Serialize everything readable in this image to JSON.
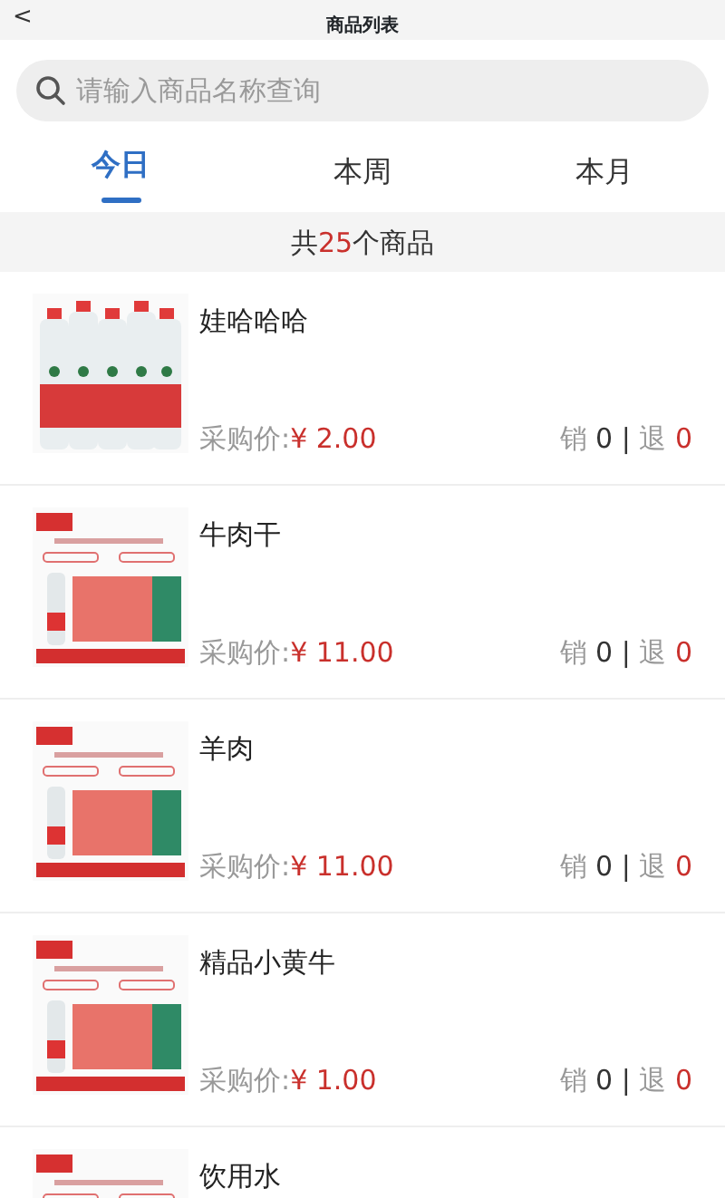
{
  "header": {
    "back": "<",
    "title": "商品列表"
  },
  "search": {
    "placeholder": "请输入商品名称查询"
  },
  "tabs": [
    {
      "label": "今日",
      "selected": true
    },
    {
      "label": "本周",
      "selected": false
    },
    {
      "label": "本月",
      "selected": false
    }
  ],
  "summary": {
    "prefix": "共",
    "count": "25",
    "suffix": "个商品"
  },
  "products": [
    {
      "name": "娃哈哈哈",
      "price_label": "采购价:",
      "price": "¥ 2.00",
      "sold_label": "销",
      "sold": "0",
      "separator": "|",
      "returned_label": "退",
      "returned": "0"
    },
    {
      "name": "牛肉干",
      "price_label": "采购价:",
      "price": "¥ 11.00",
      "sold_label": "销",
      "sold": "0",
      "separator": "|",
      "returned_label": "退",
      "returned": "0"
    },
    {
      "name": "羊肉",
      "price_label": "采购价:",
      "price": "¥ 11.00",
      "sold_label": "销",
      "sold": "0",
      "separator": "|",
      "returned_label": "退",
      "returned": "0"
    },
    {
      "name": "精品小黄牛",
      "price_label": "采购价:",
      "price": "¥ 1.00",
      "sold_label": "销",
      "sold": "0",
      "separator": "|",
      "returned_label": "退",
      "returned": "0"
    },
    {
      "name": "饮用水"
    }
  ]
}
